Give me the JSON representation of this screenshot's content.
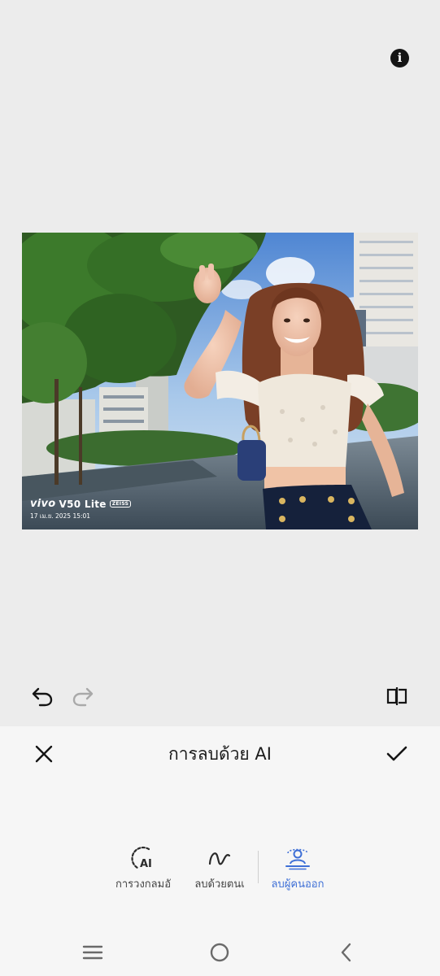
{
  "photo": {
    "watermark_brand_logo": "vivo",
    "watermark_model": "V50 Lite",
    "watermark_lens_badge": "ZEISS",
    "watermark_date": "17 เม.ย. 2025 15:01"
  },
  "toolbar": {
    "info_icon": "info-icon",
    "info_glyph": "i",
    "undo_icon": "undo-icon",
    "redo_icon": "redo-icon",
    "compare_icon": "compare-icon"
  },
  "panel": {
    "title": "การลบด้วย AI",
    "close_icon": "close-icon",
    "confirm_icon": "check-icon",
    "modes": [
      {
        "label": "การวงกลมอั",
        "icon": "ai-circle-icon",
        "active": false
      },
      {
        "label": "ลบด้วยตนเ",
        "icon": "brush-stroke-icon",
        "active": false
      },
      {
        "label": "ลบผู้คนออก",
        "icon": "remove-people-icon",
        "active": true
      }
    ]
  },
  "colors": {
    "accent": "#3e6fd6",
    "canvas_bg": "#ececec",
    "panel_bg": "#f6f6f6",
    "icon_dark": "#151515",
    "icon_disabled": "#a9a9a9"
  },
  "nav": {
    "menu_icon": "menu-icon",
    "home_icon": "home-icon",
    "back_icon": "back-icon"
  }
}
